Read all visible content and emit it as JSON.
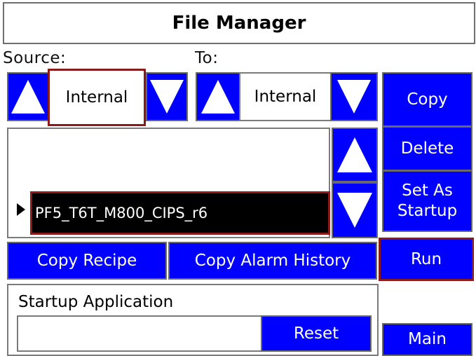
{
  "title": "File Manager",
  "source": {
    "label": "Source:",
    "value": "Internal"
  },
  "destination": {
    "label": "To:",
    "value": "Internal"
  },
  "buttons": {
    "copy": "Copy",
    "delete": "Delete",
    "set_as_startup": "Set As\nStartup",
    "copy_recipe": "Copy Recipe",
    "copy_alarm_history": "Copy Alarm History",
    "run": "Run",
    "reset": "Reset",
    "main": "Main"
  },
  "file_list": {
    "selected_file": "PF5_T6T_M800_CIPS_r6"
  },
  "startup": {
    "label": "Startup Application",
    "value": ""
  },
  "colors": {
    "button_bg": "#0000ff",
    "highlight": "#8b1a1a",
    "selected_row": "#000000"
  }
}
